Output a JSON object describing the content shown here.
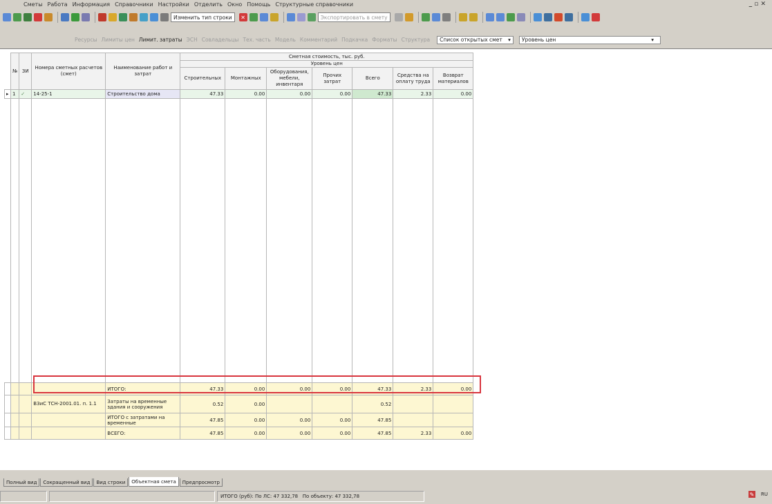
{
  "menu": [
    "Сметы",
    "Работа",
    "Информация",
    "Справочники",
    "Настройки",
    "Отделить",
    "Окно",
    "Помощь",
    "Структурные справочники"
  ],
  "toolbar": {
    "change_type_label": "Изменить тип строки",
    "export_label": "Экспортировать в смету"
  },
  "filter_bar": {
    "items": [
      "Ресурсы",
      "Лимиты цен",
      "Лимит. затраты",
      "ЭСН",
      "Совладельцы",
      "Тех. часть",
      "Модель",
      "Комментарий",
      "Подкачка",
      "Форматы",
      "Структура"
    ],
    "active_item": "Лимит. затраты",
    "list_label": "Список открытых смет",
    "price_level_label": "Уровень цен"
  },
  "grid": {
    "headers": {
      "num": "№",
      "sr": "ЗИ",
      "estimate": "Номера сметных расчетов (смет)",
      "name": "Наименование работ и затрат",
      "group": "Сметная стоимость, тыс. руб.",
      "subgroup": "Уровень цен",
      "construction": "Строительных",
      "mounting": "Монтажных",
      "equipment": "Оборудования, мебели, инвентаря",
      "other": "Прочих затрат",
      "total": "Всего",
      "salary": "Средства на оплату труда",
      "return": "Возврат материалов"
    },
    "row": {
      "num": "1",
      "estimate": "14-25-1",
      "name": "Строительство дома",
      "construction": "47.33",
      "mounting": "0.00",
      "equipment": "0.00",
      "other": "0.00",
      "total": "47.33",
      "salary": "2.33",
      "return": "0.00"
    },
    "totals": [
      {
        "estimate": "",
        "name": "ИТОГО:",
        "construction": "47.33",
        "mounting": "0.00",
        "equipment": "0.00",
        "other": "0.00",
        "total": "47.33",
        "salary": "2.33",
        "return": "0.00"
      },
      {
        "estimate": "ВЗиС ТСН-2001.01. п. 1.1",
        "name": "Затраты на временные здания и сооружения",
        "construction": "0.52",
        "mounting": "0.00",
        "equipment": "",
        "other": "",
        "total": "0.52",
        "salary": "",
        "return": ""
      },
      {
        "estimate": "",
        "name": "ИТОГО с затратами на временные",
        "construction": "47.85",
        "mounting": "0.00",
        "equipment": "0.00",
        "other": "0.00",
        "total": "47.85",
        "salary": "",
        "return": ""
      },
      {
        "estimate": "",
        "name": "ВСЕГО:",
        "construction": "47.85",
        "mounting": "0.00",
        "equipment": "0.00",
        "other": "0.00",
        "total": "47.85",
        "salary": "2.33",
        "return": "0.00"
      }
    ]
  },
  "tabs": [
    "Полный вид",
    "Сокращенный вид",
    "Вид строки",
    "Объектная смета",
    "Предпросмотр"
  ],
  "active_tab": "Объектная смета",
  "status": {
    "left": "",
    "total_label": "ИТОГО (руб): По ЛС: 47 332,78",
    "object_label": "По объекту: 47 332,78",
    "lang": "RU"
  }
}
